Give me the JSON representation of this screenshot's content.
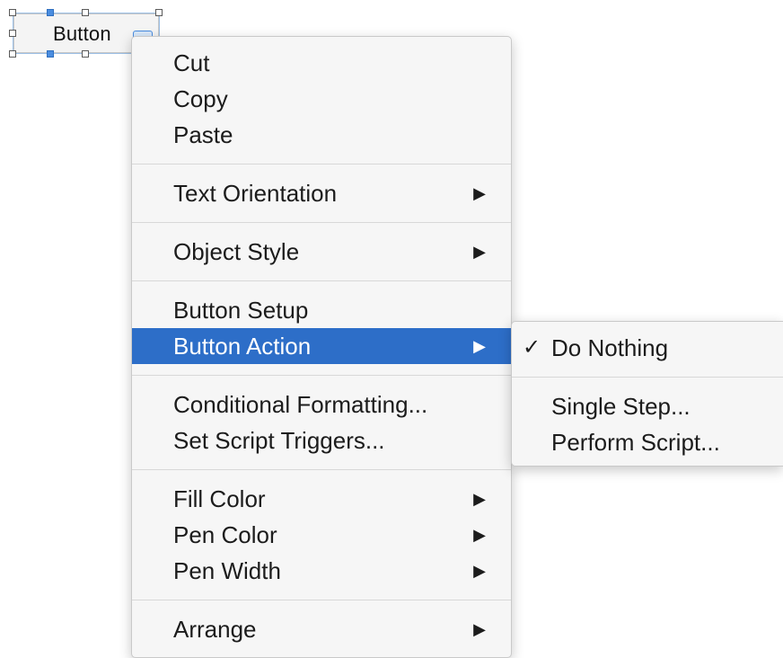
{
  "layout_object": {
    "label": "Button"
  },
  "context_menu": {
    "groups": [
      [
        {
          "label": "Cut"
        },
        {
          "label": "Copy"
        },
        {
          "label": "Paste"
        }
      ],
      [
        {
          "label": "Text Orientation",
          "submenu_arrow": "▶"
        }
      ],
      [
        {
          "label": "Object Style",
          "submenu_arrow": "▶"
        }
      ],
      [
        {
          "label": "Button Setup"
        },
        {
          "label": "Button Action",
          "submenu_arrow": "▶",
          "highlighted": true
        }
      ],
      [
        {
          "label": "Conditional Formatting..."
        },
        {
          "label": "Set Script Triggers..."
        }
      ],
      [
        {
          "label": "Fill Color",
          "submenu_arrow": "▶"
        },
        {
          "label": "Pen Color",
          "submenu_arrow": "▶"
        },
        {
          "label": "Pen Width",
          "submenu_arrow": "▶"
        }
      ],
      [
        {
          "label": "Arrange",
          "submenu_arrow": "▶"
        }
      ]
    ]
  },
  "button_action_submenu": {
    "checkmark": "✓",
    "items": [
      {
        "label": "Do Nothing",
        "checked": true
      },
      {
        "label": "Single Step..."
      },
      {
        "label": "Perform Script..."
      }
    ]
  },
  "colors": {
    "highlight": "#2d6ec8",
    "menu_background": "#f6f6f6",
    "selection_handle": "#4a8de0"
  }
}
